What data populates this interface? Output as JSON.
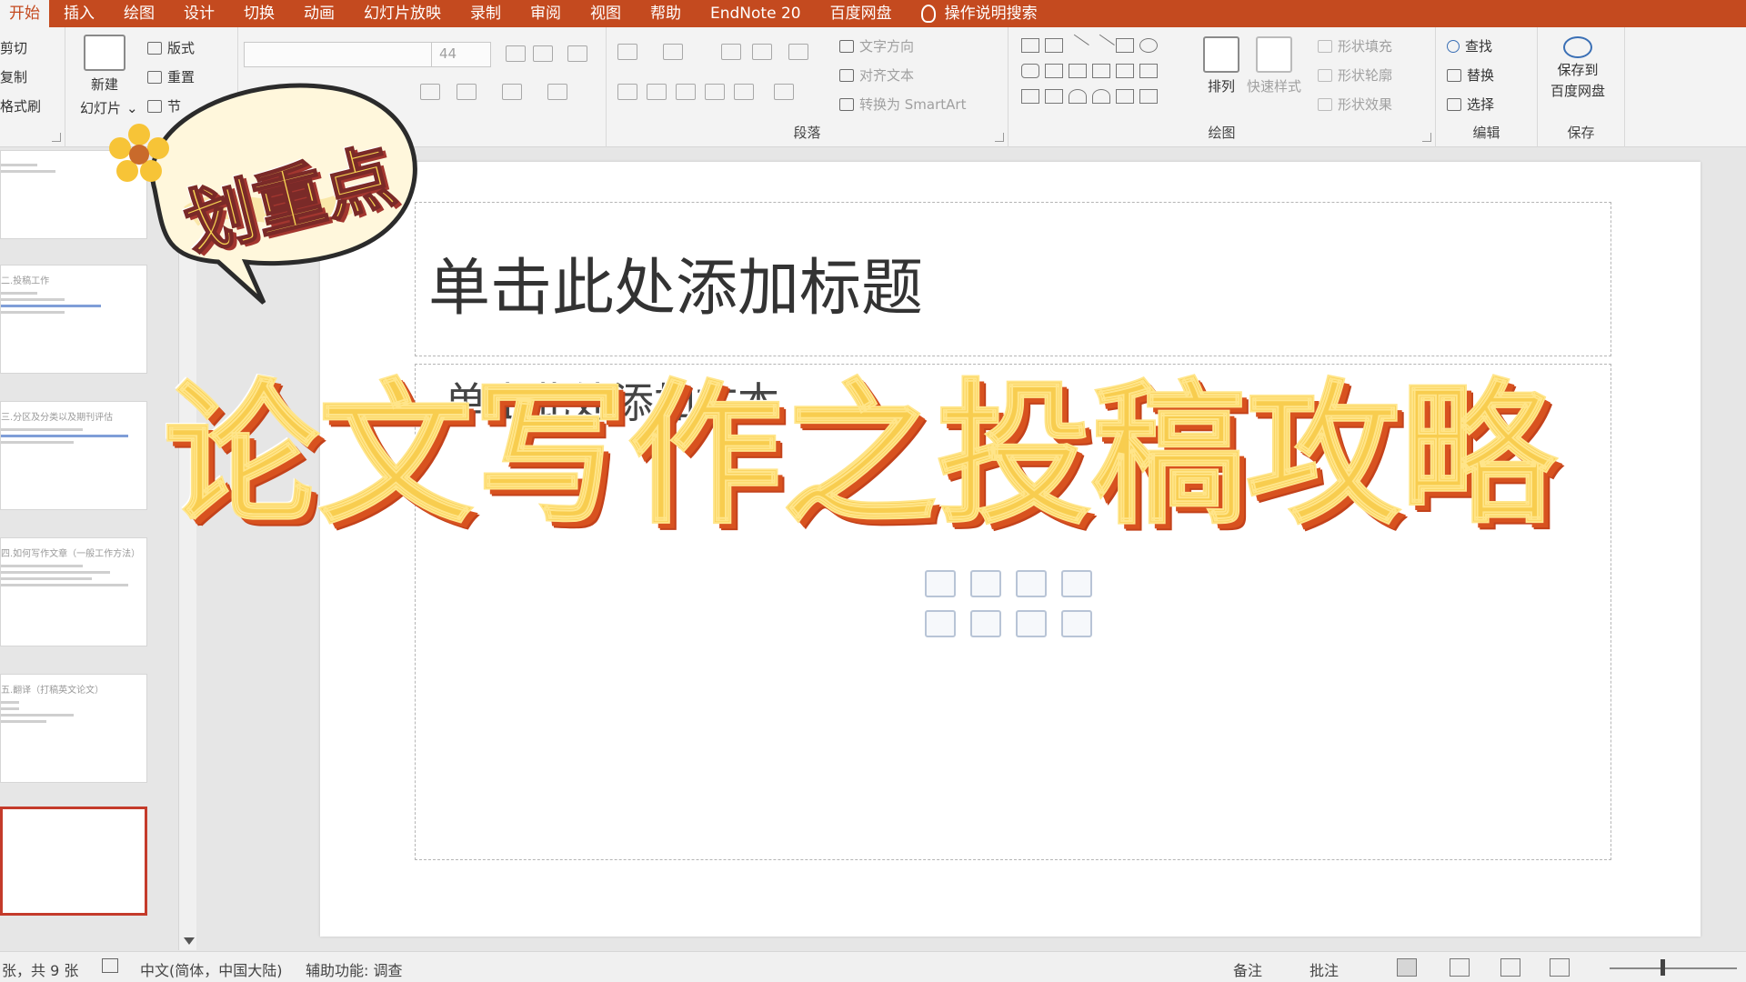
{
  "ribbon_tabs": [
    "开始",
    "插入",
    "绘图",
    "设计",
    "切换",
    "动画",
    "幻灯片放映",
    "录制",
    "审阅",
    "视图",
    "帮助",
    "EndNote 20",
    "百度网盘"
  ],
  "tell_me": "操作说明搜索",
  "clipboard": {
    "cut": "剪切",
    "copy": "复制",
    "format_painter": "格式刷"
  },
  "slides_group": {
    "new_slide_line1": "新建",
    "new_slide_line2": "幻灯片",
    "layout": "版式",
    "reset": "重置",
    "section": "节",
    "label": "幻灯片"
  },
  "font_group": {
    "font_name": "",
    "font_size": "44"
  },
  "paragraph_group": {
    "text_direction": "文字方向",
    "align_text": "对齐文本",
    "convert_smartart": "转换为 SmartArt",
    "label": "段落"
  },
  "drawing_group": {
    "arrange": "排列",
    "quick_styles": "快速样式",
    "shape_fill": "形状填充",
    "shape_outline": "形状轮廓",
    "shape_effects": "形状效果",
    "label": "绘图"
  },
  "editing_group": {
    "find": "查找",
    "replace": "替换",
    "select": "选择",
    "label": "编辑"
  },
  "save_group": {
    "save_line1": "保存到",
    "save_line2": "百度网盘",
    "label": "保存"
  },
  "thumbnails": [
    {
      "title": ""
    },
    {
      "title": "二.投稿工作"
    },
    {
      "title": "三.分区及分类以及期刊评估"
    },
    {
      "title": "四.如何写作文章（一般工作方法）"
    },
    {
      "title": "五.翻译（打稿英文论文）"
    },
    {
      "title": ""
    }
  ],
  "slide": {
    "title_placeholder": "单击此处添加标题",
    "body_placeholder": "单击此处添加文本"
  },
  "overlay": {
    "bubble_text": "划重点",
    "headline": "论文写作之投稿攻略"
  },
  "statusbar": {
    "slide_count": "张，共 9 张",
    "language": "中文(简体，中国大陆)",
    "accessibility": "辅助功能: 调查",
    "notes": "备注",
    "comments": "批注"
  },
  "colors": {
    "ribbon_accent": "#c44a1f",
    "headline_fill": "#f8cd4f",
    "headline_shadow": "#d8521f",
    "selected_thumb_border": "#c43b2b"
  }
}
